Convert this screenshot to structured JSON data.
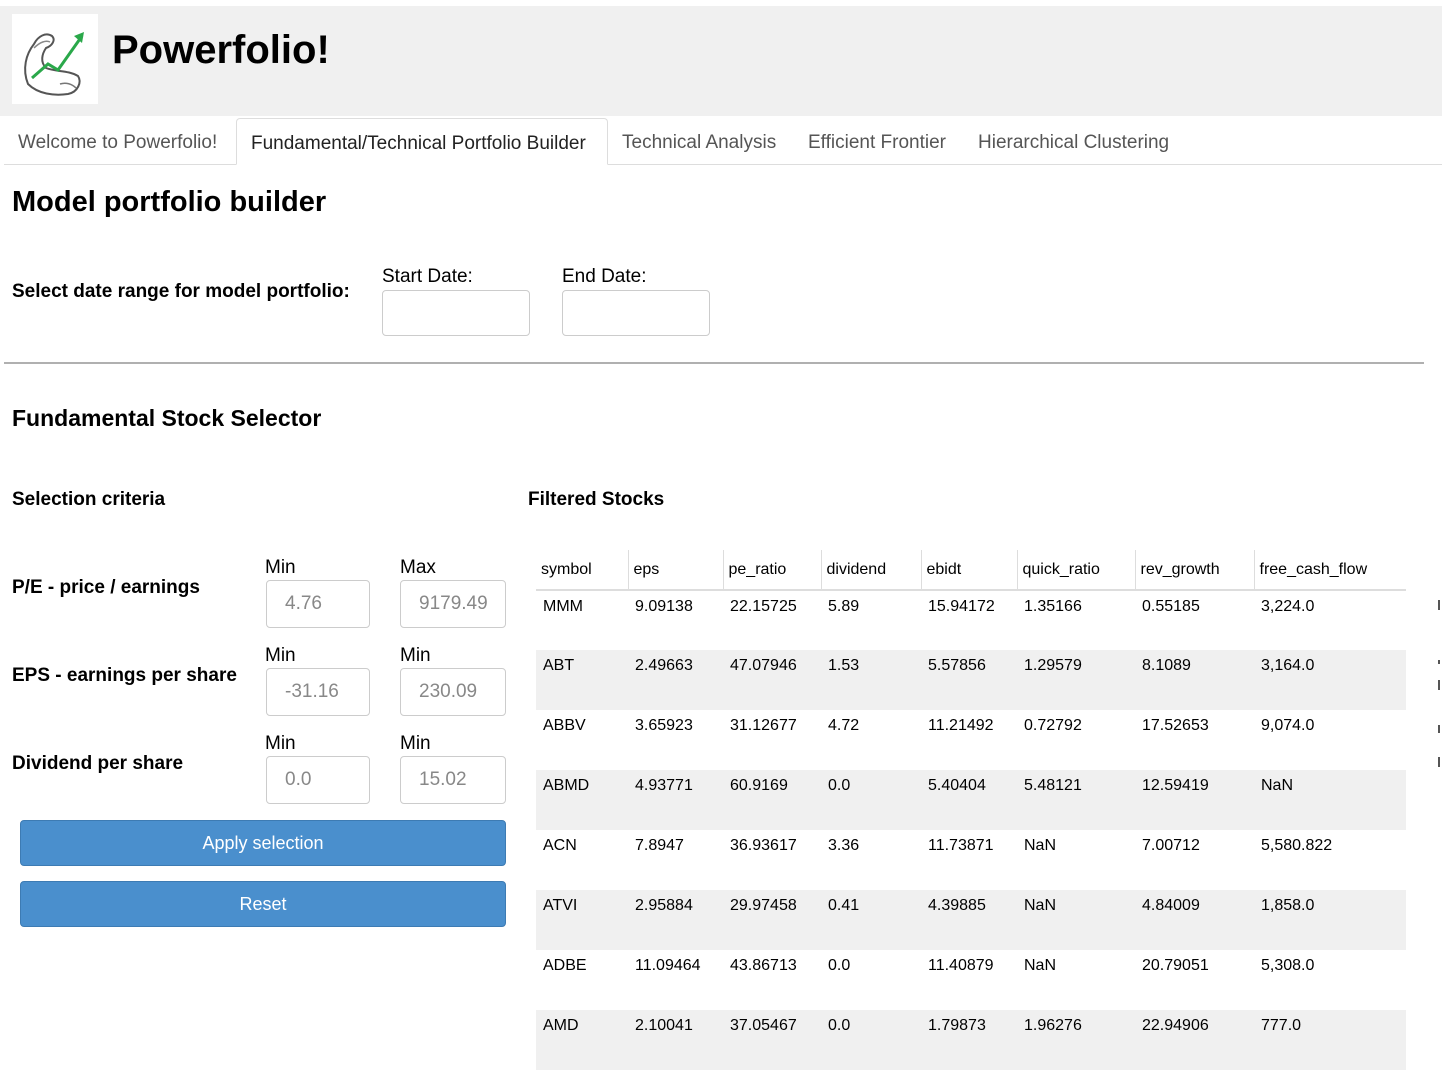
{
  "header": {
    "title": "Powerfolio!",
    "logo_icon": "flexed-arm-growth-arrow-logo"
  },
  "tabs": [
    {
      "label": "Welcome to Powerfolio!",
      "active": false
    },
    {
      "label": "Fundamental/Technical Portfolio Builder",
      "active": true
    },
    {
      "label": "Technical Analysis",
      "active": false
    },
    {
      "label": "Efficient Frontier",
      "active": false
    },
    {
      "label": "Hierarchical Clustering",
      "active": false
    }
  ],
  "builder": {
    "heading": "Model portfolio builder",
    "date_range_label": "Select date range for model portfolio:",
    "start_date_label": "Start Date:",
    "start_date_value": "",
    "end_date_label": "End Date:",
    "end_date_value": ""
  },
  "selector": {
    "heading": "Fundamental Stock Selector",
    "criteria_heading": "Selection criteria",
    "criteria": [
      {
        "label": "P/E - price / earnings",
        "min_label": "Min",
        "max_label": "Max",
        "min_value": "4.76",
        "max_value": "9179.49"
      },
      {
        "label": "EPS - earnings per share",
        "min_label": "Min",
        "max_label": "Min",
        "min_value": "-31.16",
        "max_value": "230.09"
      },
      {
        "label": "Dividend per share",
        "min_label": "Min",
        "max_label": "Min",
        "min_value": "0.0",
        "max_value": "15.02"
      }
    ],
    "apply_label": "Apply selection",
    "reset_label": "Reset"
  },
  "filtered": {
    "heading": "Filtered Stocks",
    "columns": [
      "symbol",
      "eps",
      "pe_ratio",
      "dividend",
      "ebidt",
      "quick_ratio",
      "rev_growth",
      "free_cash_flow"
    ],
    "rows": [
      [
        "MMM",
        "9.09138",
        "22.15725",
        "5.89",
        "15.94172",
        "1.35166",
        "0.55185",
        "3,224.0"
      ],
      [
        "ABT",
        "2.49663",
        "47.07946",
        "1.53",
        "5.57856",
        "1.29579",
        "8.1089",
        "3,164.0"
      ],
      [
        "ABBV",
        "3.65923",
        "31.12677",
        "4.72",
        "11.21492",
        "0.72792",
        "17.52653",
        "9,074.0"
      ],
      [
        "ABMD",
        "4.93771",
        "60.9169",
        "0.0",
        "5.40404",
        "5.48121",
        "12.59419",
        "NaN"
      ],
      [
        "ACN",
        "7.8947",
        "36.93617",
        "3.36",
        "11.73871",
        "NaN",
        "7.00712",
        "5,580.822"
      ],
      [
        "ATVI",
        "2.95884",
        "29.97458",
        "0.41",
        "4.39885",
        "NaN",
        "4.84009",
        "1,858.0"
      ],
      [
        "ADBE",
        "11.09464",
        "43.86713",
        "0.0",
        "11.40879",
        "NaN",
        "20.79051",
        "5,308.0"
      ],
      [
        "AMD",
        "2.10041",
        "37.05467",
        "0.0",
        "1.79873",
        "1.96276",
        "22.94906",
        "777.0"
      ]
    ]
  }
}
